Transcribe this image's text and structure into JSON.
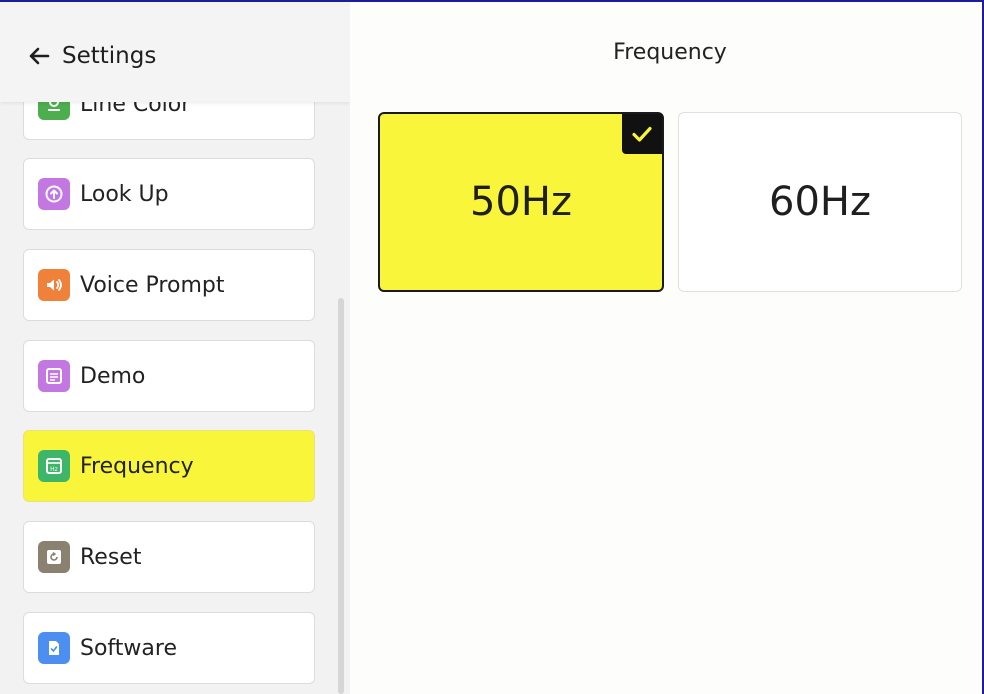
{
  "header": {
    "back_label": "Settings"
  },
  "sidebar": {
    "items": [
      {
        "label": "Line Color",
        "icon": "line-color-icon",
        "color": "#4cae4f"
      },
      {
        "label": "Look Up",
        "icon": "arrow-up-circle-icon",
        "color": "#c377e0"
      },
      {
        "label": "Voice Prompt",
        "icon": "speaker-icon",
        "color": "#f0813a"
      },
      {
        "label": "Demo",
        "icon": "document-icon",
        "color": "#c377e0"
      },
      {
        "label": "Frequency",
        "icon": "hz-icon",
        "color": "#3db66a",
        "selected": true
      },
      {
        "label": "Reset",
        "icon": "reset-icon",
        "color": "#8a8170"
      },
      {
        "label": "Software",
        "icon": "file-check-icon",
        "color": "#4c8ff0"
      }
    ]
  },
  "main": {
    "title": "Frequency",
    "options": [
      {
        "label": "50Hz",
        "selected": true
      },
      {
        "label": "60Hz",
        "selected": false
      }
    ]
  },
  "colors": {
    "accent": "#f8f53a",
    "sidebar_bg": "#f2f2f2"
  }
}
